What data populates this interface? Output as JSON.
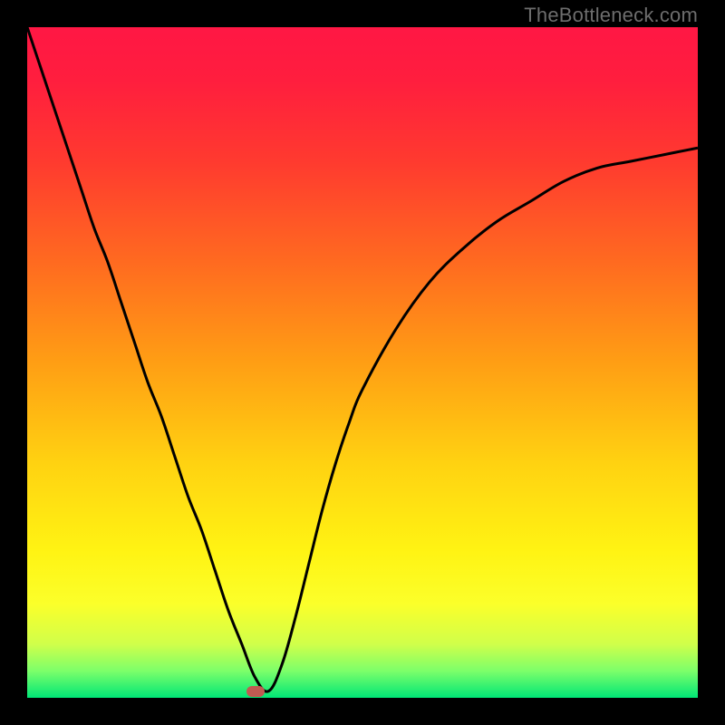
{
  "watermark": "TheBottleneck.com",
  "chart_data": {
    "type": "line",
    "title": "",
    "xlabel": "",
    "ylabel": "",
    "xlim": [
      0,
      100
    ],
    "ylim": [
      0,
      100
    ],
    "grid": false,
    "gradient_stops": [
      {
        "offset": 0.0,
        "color": "#ff1744"
      },
      {
        "offset": 0.08,
        "color": "#ff1e3e"
      },
      {
        "offset": 0.2,
        "color": "#ff3a2f"
      },
      {
        "offset": 0.35,
        "color": "#ff6a20"
      },
      {
        "offset": 0.5,
        "color": "#ff9e14"
      },
      {
        "offset": 0.65,
        "color": "#ffd211"
      },
      {
        "offset": 0.78,
        "color": "#fff313"
      },
      {
        "offset": 0.86,
        "color": "#fbff2a"
      },
      {
        "offset": 0.92,
        "color": "#d0ff4a"
      },
      {
        "offset": 0.96,
        "color": "#7cff6a"
      },
      {
        "offset": 1.0,
        "color": "#00e676"
      }
    ],
    "series": [
      {
        "name": "bottleneck-curve",
        "x": [
          0,
          2,
          4,
          6,
          8,
          10,
          12,
          14,
          16,
          18,
          20,
          22,
          24,
          26,
          28,
          30,
          32,
          34,
          36,
          38,
          40,
          42,
          44,
          46,
          48,
          50,
          55,
          60,
          65,
          70,
          75,
          80,
          85,
          90,
          95,
          100
        ],
        "y": [
          100,
          94,
          88,
          82,
          76,
          70,
          65,
          59,
          53,
          47,
          42,
          36,
          30,
          25,
          19,
          13,
          8,
          3,
          1,
          5,
          12,
          20,
          28,
          35,
          41,
          46,
          55,
          62,
          67,
          71,
          74,
          77,
          79,
          80,
          81,
          82
        ]
      }
    ],
    "minimum_marker": {
      "x": 34,
      "y": 1
    }
  }
}
